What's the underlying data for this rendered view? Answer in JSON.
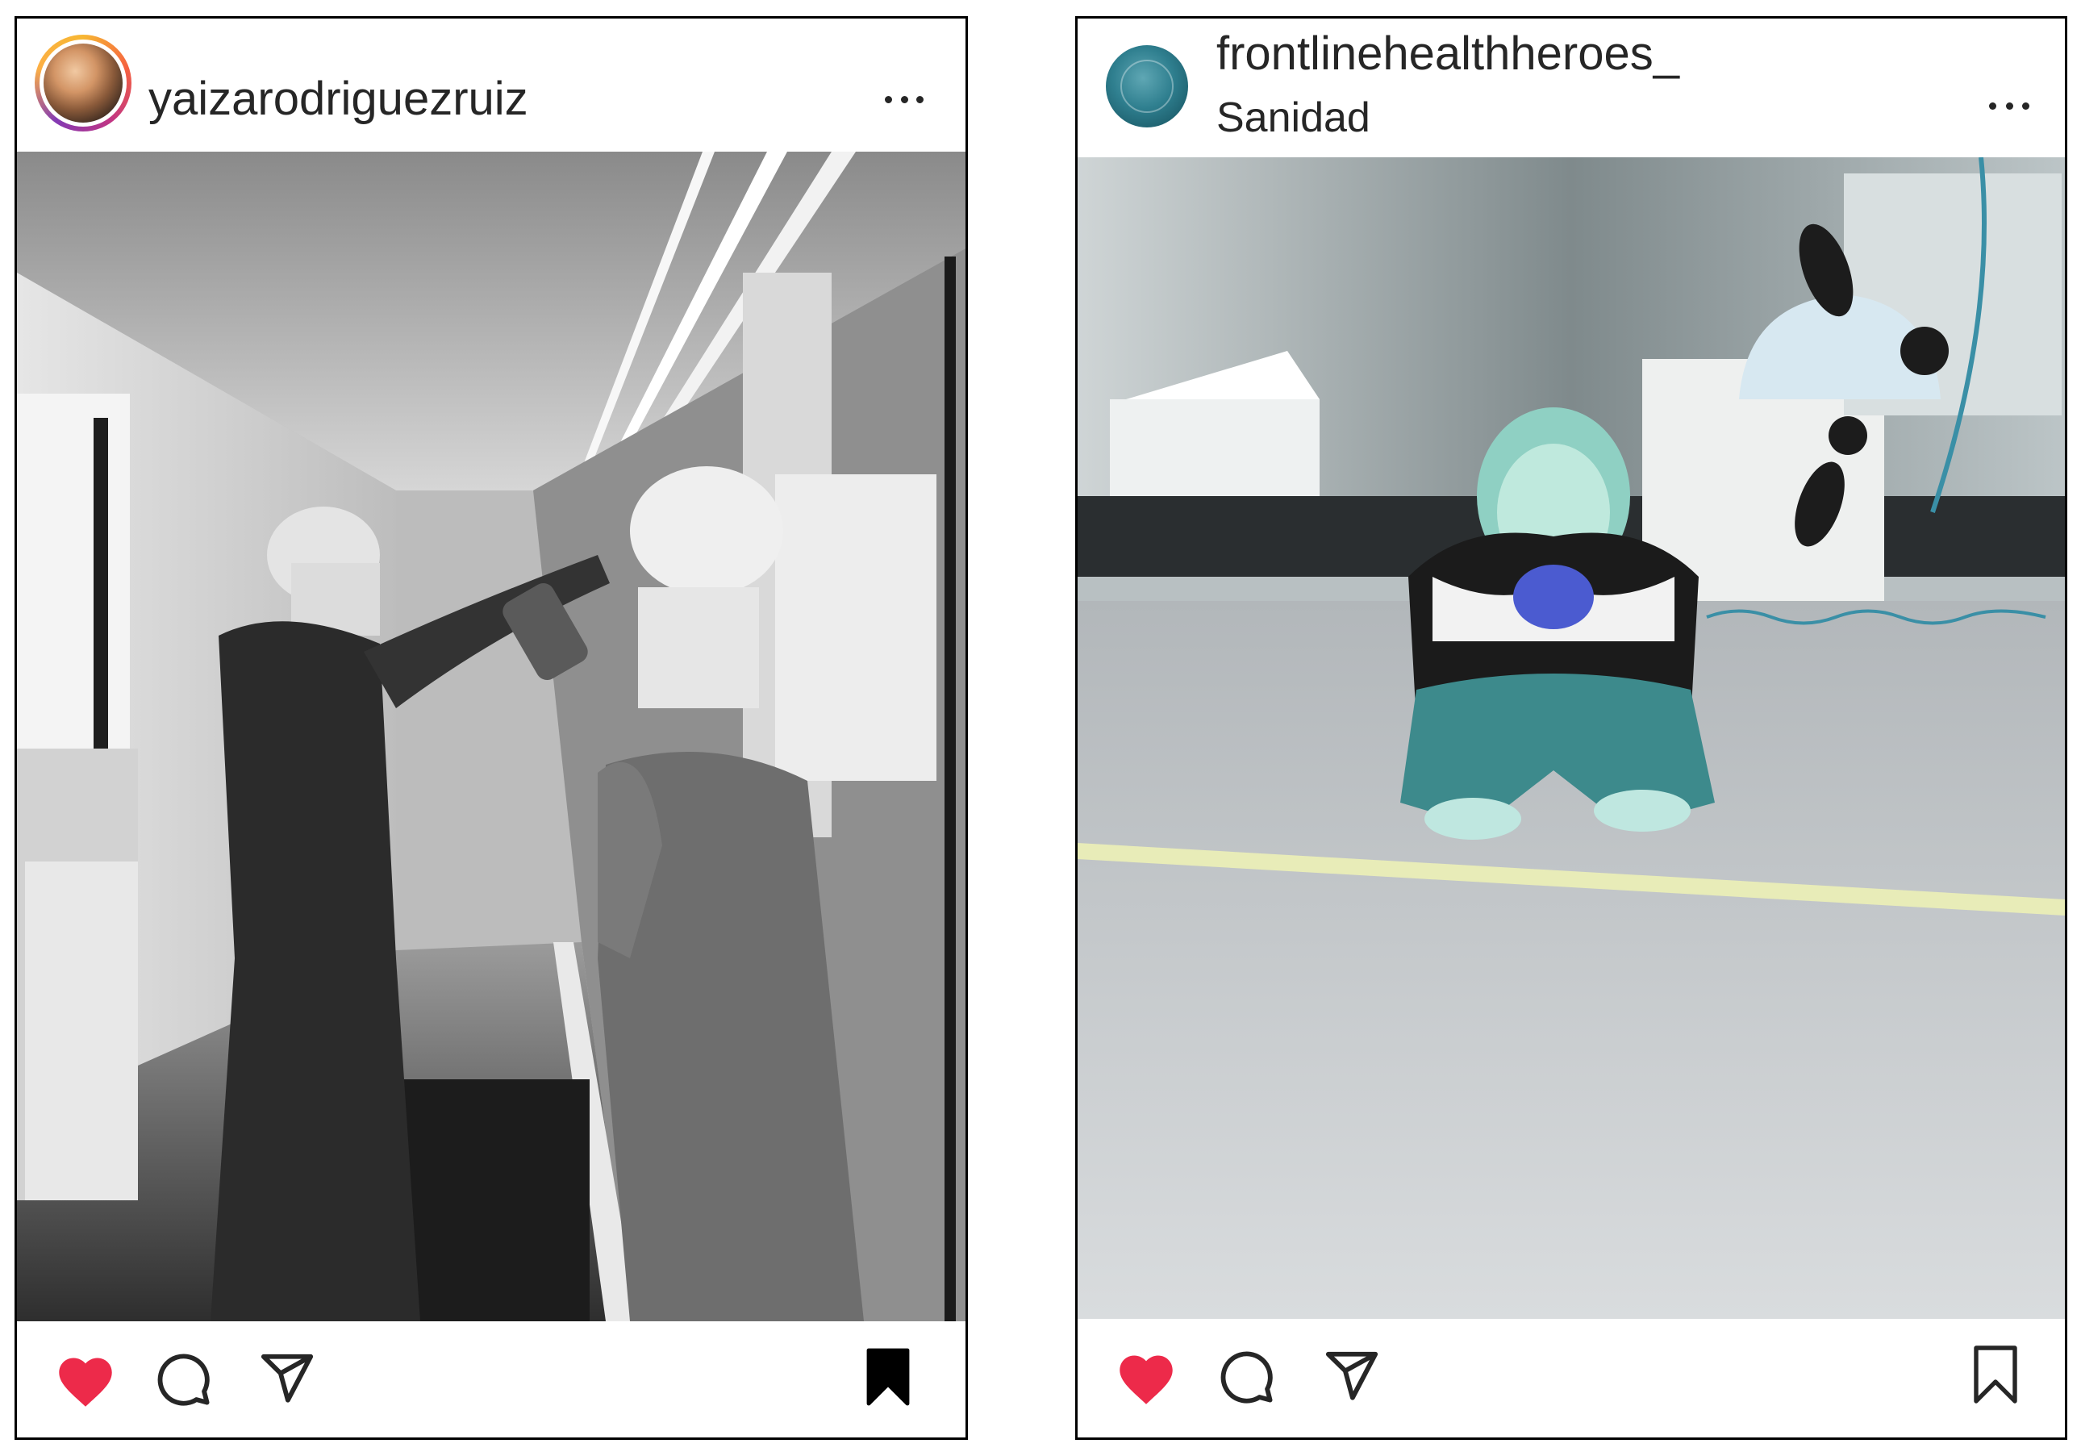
{
  "colors": {
    "like": "#ed2a4a",
    "text": "#262626",
    "border": "#000000"
  },
  "posts": [
    {
      "username": "yaizarodriguezruiz",
      "location": "",
      "avatar": "story-ring-avatar",
      "image": "black-and-white hospital corridor photo, two nurses in caps and masks",
      "liked": true,
      "saved": true,
      "icons": [
        "heart-icon",
        "comment-icon",
        "share-icon",
        "bookmark-icon"
      ]
    },
    {
      "username": "frontlinehealthheroes_",
      "location": "Sanidad",
      "avatar": "plain-avatar",
      "image": "color photo of a health worker in PPE crouching in a hospital hallway",
      "liked": true,
      "saved": false,
      "icons": [
        "heart-icon",
        "comment-icon",
        "share-icon",
        "bookmark-icon"
      ]
    }
  ]
}
